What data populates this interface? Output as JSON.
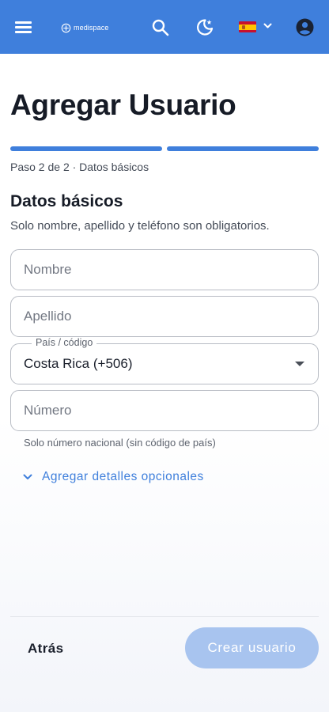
{
  "header": {
    "logo_text": "medispace",
    "brand_color": "#3f7fdc",
    "icons": [
      "menu-icon",
      "search-icon",
      "theme-toggle-icon",
      "flag-es-icon",
      "chevron-down-icon",
      "account-icon"
    ]
  },
  "page": {
    "title": "Agregar Usuario",
    "progress": {
      "current_step": 2,
      "total_steps": 2,
      "text": "Paso 2 de 2 · Datos básicos"
    }
  },
  "section": {
    "title": "Datos básicos",
    "subtitle": "Solo nombre, apellido y teléfono son obligatorios."
  },
  "form": {
    "first_name": {
      "placeholder": "Nombre",
      "value": ""
    },
    "last_name": {
      "placeholder": "Apellido",
      "value": ""
    },
    "country": {
      "label": "País / código",
      "value": "Costa Rica (+506)"
    },
    "number": {
      "placeholder": "Número",
      "value": "",
      "hint": "Solo número nacional (sin código de país)"
    },
    "optional_toggle": "Agregar detalles opcionales"
  },
  "footer": {
    "back_label": "Atrás",
    "create_label": "Crear usuario",
    "create_disabled": true
  }
}
